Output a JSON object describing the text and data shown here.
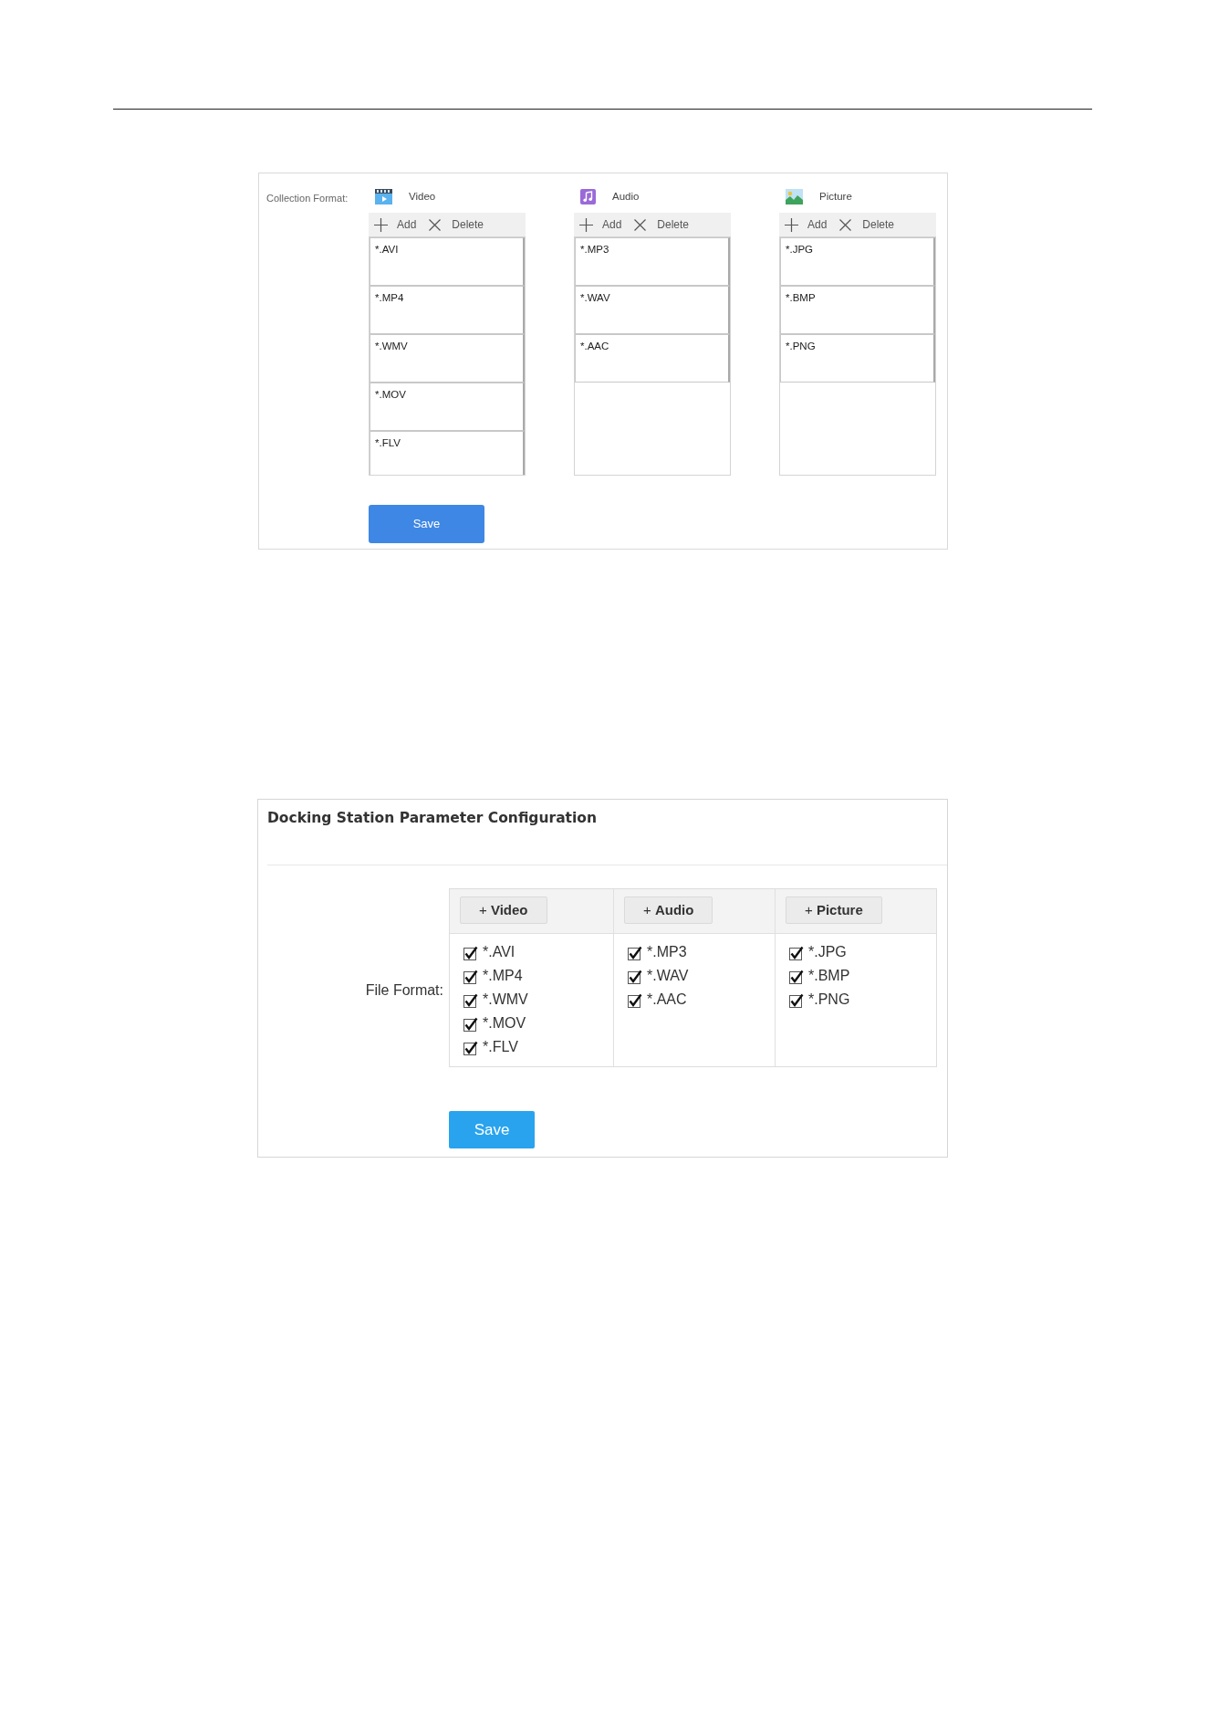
{
  "collection_panel": {
    "label": "Collection Format:",
    "categories": [
      {
        "kind": "video",
        "title": "Video",
        "add_label": "Add",
        "delete_label": "Delete",
        "items": [
          "*.AVI",
          "*.MP4",
          "*.WMV",
          "*.MOV",
          "*.FLV"
        ]
      },
      {
        "kind": "audio",
        "title": "Audio",
        "add_label": "Add",
        "delete_label": "Delete",
        "items": [
          "*.MP3",
          "*.WAV",
          "*.AAC"
        ]
      },
      {
        "kind": "picture",
        "title": "Picture",
        "add_label": "Add",
        "delete_label": "Delete",
        "items": [
          "*.JPG",
          "*.BMP",
          "*.PNG"
        ]
      }
    ],
    "save_button": "Save"
  },
  "docking_panel": {
    "title": "Docking Station Parameter Configuration",
    "field_label": "File Format:",
    "columns": [
      {
        "button": "+ **Video**",
        "items": [
          {
            "label": "*.AVI",
            "checked": true
          },
          {
            "label": "*.MP4",
            "checked": true
          },
          {
            "label": "*.WMV",
            "checked": true
          },
          {
            "label": "*.MOV",
            "checked": true
          },
          {
            "label": "*.FLV",
            "checked": true
          }
        ]
      },
      {
        "button": "+ **Audio**",
        "items": [
          {
            "label": "*.MP3",
            "checked": true
          },
          {
            "label": "*.WAV",
            "checked": true
          },
          {
            "label": "*.AAC",
            "checked": true
          }
        ]
      },
      {
        "button": "+ **Picture**",
        "items": [
          {
            "label": "*.JPG",
            "checked": true
          },
          {
            "label": "*.BMP",
            "checked": true
          },
          {
            "label": "*.PNG",
            "checked": true
          }
        ]
      }
    ],
    "save_button": "Save"
  }
}
